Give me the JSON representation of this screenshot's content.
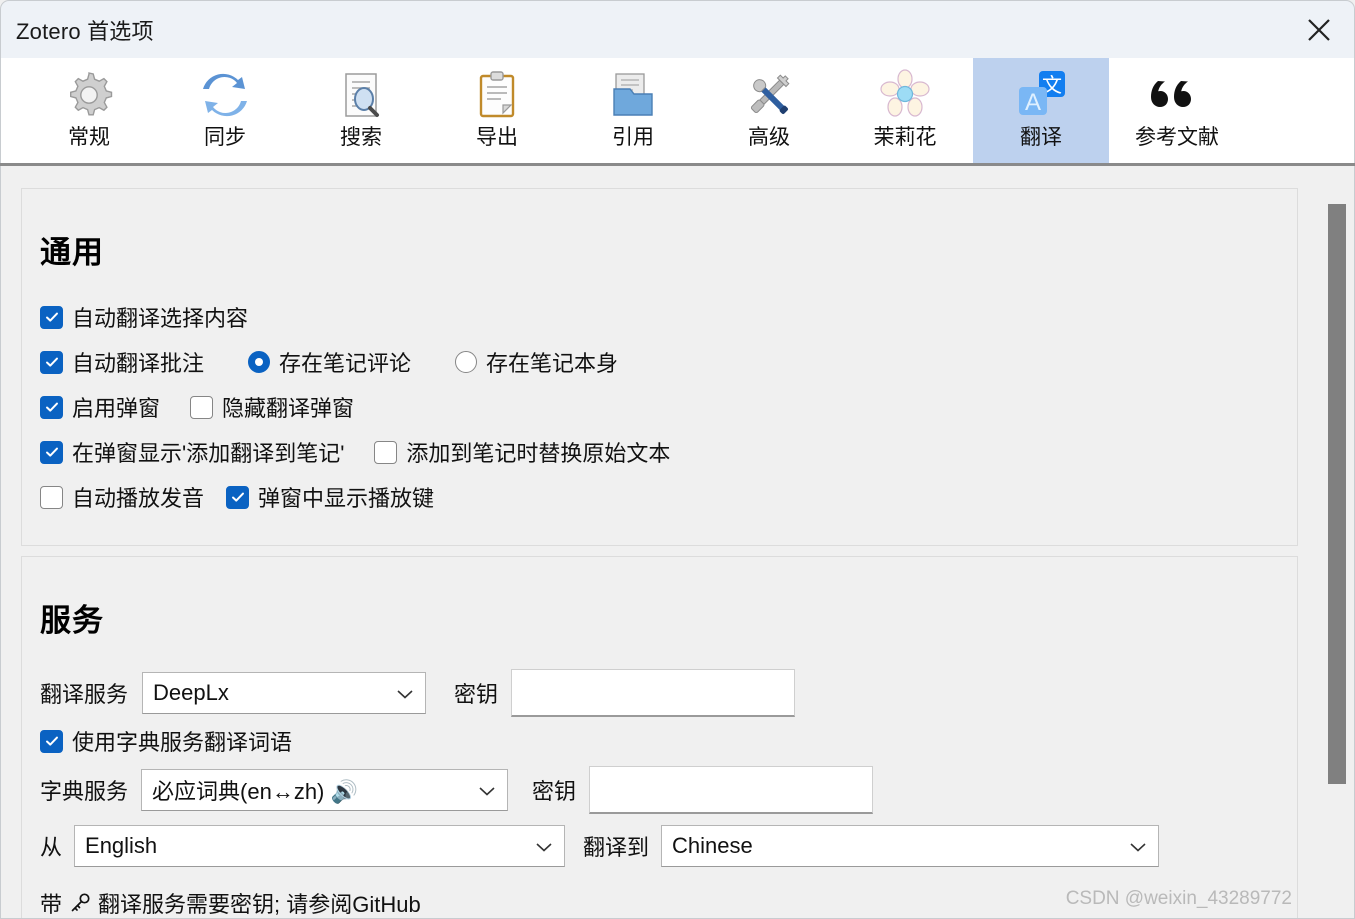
{
  "window": {
    "title": "Zotero 首选项",
    "close_label": "✕",
    "close_icon": "close-icon"
  },
  "toolbar": {
    "tabs": [
      {
        "label": "常规",
        "icon": "gear-icon",
        "selected": false
      },
      {
        "label": "同步",
        "icon": "sync-icon",
        "selected": false
      },
      {
        "label": "搜索",
        "icon": "search-doc-icon",
        "selected": false
      },
      {
        "label": "导出",
        "icon": "clipboard-icon",
        "selected": false
      },
      {
        "label": "引用",
        "icon": "folder-docs-icon",
        "selected": false
      },
      {
        "label": "高级",
        "icon": "tools-icon",
        "selected": false
      },
      {
        "label": "茉莉花",
        "icon": "flower-icon",
        "selected": false
      },
      {
        "label": "翻译",
        "icon": "translate-icon",
        "selected": true
      },
      {
        "label": "参考文献",
        "icon": "quote-icon",
        "selected": false
      }
    ]
  },
  "general": {
    "title": "通用",
    "auto_translate_selection": {
      "label": "自动翻译选择内容",
      "checked": true
    },
    "auto_translate_annotation": {
      "label": "自动翻译批注",
      "checked": true
    },
    "annotation_mode": {
      "options": [
        {
          "label": "存在笔记评论",
          "selected": true
        },
        {
          "label": "存在笔记本身",
          "selected": false
        }
      ]
    },
    "enable_popup": {
      "label": "启用弹窗",
      "checked": true
    },
    "hide_translate_popup": {
      "label": "隐藏翻译弹窗",
      "checked": false
    },
    "show_add_to_note": {
      "label": "在弹窗显示'添加翻译到笔记'",
      "checked": true
    },
    "replace_original_text": {
      "label": "添加到笔记时替换原始文本",
      "checked": false
    },
    "auto_play_audio": {
      "label": "自动播放发音",
      "checked": false
    },
    "show_play_button": {
      "label": "弹窗中显示播放键",
      "checked": true
    }
  },
  "service": {
    "title": "服务",
    "translate_service": {
      "label": "翻译服务",
      "value": "DeepLx",
      "options": [
        "DeepLx"
      ]
    },
    "translate_secret": {
      "label": "密钥",
      "value": "",
      "placeholder": ""
    },
    "use_dictionary": {
      "label": "使用字典服务翻译词语",
      "checked": true
    },
    "dictionary_service": {
      "label": "字典服务",
      "value": "必应词典(en↔zh) 🔊",
      "value_text": "必应词典(en↔zh)",
      "value_icon": "speaker-icon",
      "options": [
        "必应词典(en↔zh)"
      ]
    },
    "dictionary_secret": {
      "label": "密钥",
      "value": "",
      "placeholder": ""
    },
    "from": {
      "label": "从",
      "value": "English",
      "options": [
        "English"
      ]
    },
    "to": {
      "label": "翻译到",
      "value": "Chinese",
      "options": [
        "Chinese"
      ]
    },
    "note_prefix": "带",
    "note_icon": "key-icon",
    "note_text": "翻译服务需要密钥; 请参阅GitHub"
  },
  "watermark": "CSDN @weixin_43289772",
  "colors": {
    "accent": "#0a62c2",
    "selected_tab_bg": "#bdd1ee",
    "titlebar_bg": "#eef2f7",
    "panel_bg": "#f0f0f0",
    "scrollbar_thumb": "#808080"
  }
}
